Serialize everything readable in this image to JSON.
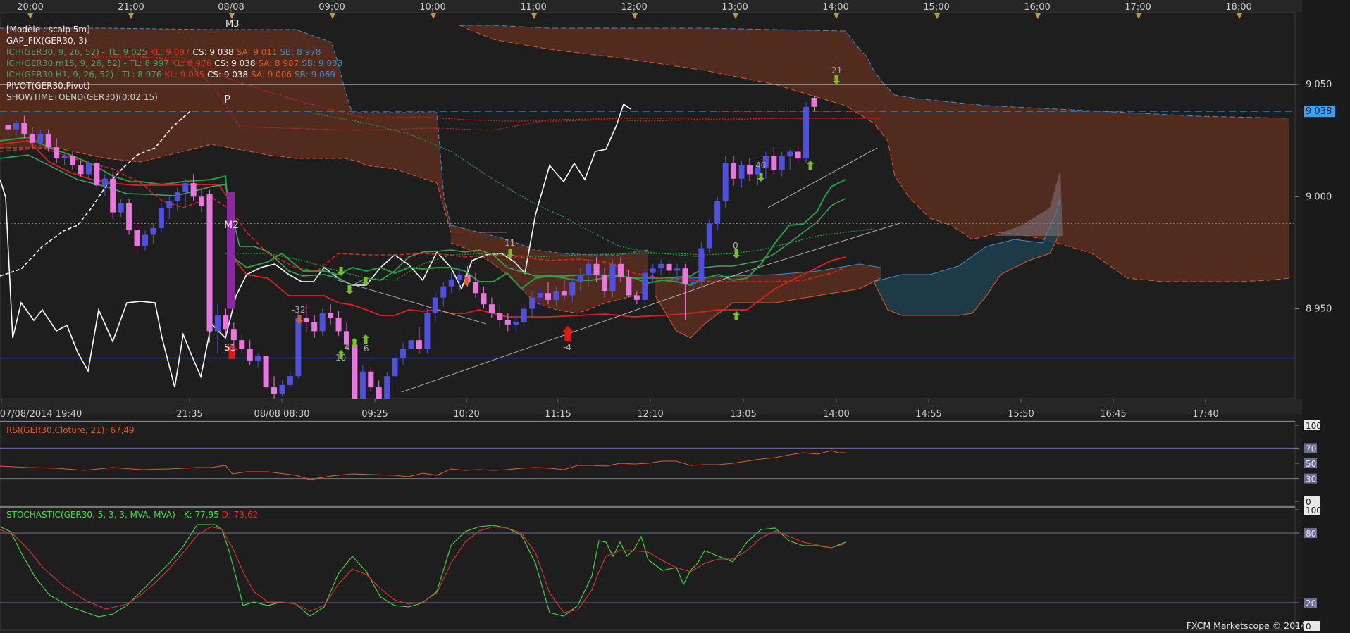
{
  "top_axis": [
    "20:00",
    "21:00",
    "08/08",
    "09:00",
    "10:00",
    "11:00",
    "12:00",
    "13:00",
    "14:00",
    "15:00",
    "16:00",
    "17:00",
    "18:00"
  ],
  "bottom_axis": [
    "07/08/2014 19:40",
    "21:35",
    "08/08 08:30",
    "09:25",
    "10:20",
    "11:15",
    "12:10",
    "13:05",
    "14:00",
    "14:55",
    "15:50",
    "16:45",
    "17:40"
  ],
  "legend": {
    "model": "[Modèle : scalp 5m]",
    "gap": "GAP_FIX(GER30, 3)",
    "ich5": {
      "name": "ICH(GER30, 9, 26, 52) -",
      "tl": "TL: 9 025",
      "kl": "KL: 9 097",
      "cs": "CS: 9 038",
      "sa": "SA: 9 011",
      "sb": "SB: 8 978"
    },
    "ich15": {
      "name": "ICH(GER30.m15, 9, 26, 52) -",
      "tl": "TL: 8 997",
      "kl": "KL: 8 976",
      "cs": "CS: 9 038",
      "sa": "SA: 8 987",
      "sb": "SB: 9 033"
    },
    "ichH1": {
      "name": "ICH(GER30.H1, 9, 26, 52) -",
      "tl": "TL: 8 976",
      "kl": "KL: 9 035",
      "cs": "CS: 9 038",
      "sa": "SA: 9 006",
      "sb": "SB: 9 069"
    },
    "pivot": "PIVOT(GER30,Pivot)",
    "showtime": "SHOWTIMETOEND(GER30)(0:02:15)"
  },
  "price_axis": {
    "ticks": [
      "9 050",
      "9 000",
      "8 950"
    ],
    "last_price": "9 038"
  },
  "chart_labels": [
    "M3",
    "P",
    "M2",
    "S1",
    "-32",
    "4",
    "10",
    "6",
    "11",
    "-4",
    "0",
    "40",
    "21"
  ],
  "rsi": {
    "title": "RSI(GER30.Cloture, 21): 67,49",
    "levels": [
      "100",
      "70",
      "50",
      "30",
      "0"
    ]
  },
  "stochastic": {
    "title": "STOCHASTIC(GER30, 5, 3, 3, MVA, MVA) -",
    "k": "K: 77,95",
    "d": "D: 73,62",
    "levels": [
      "100",
      "80",
      "20",
      "0"
    ]
  },
  "credit": "FXCM Marketscope © 2014",
  "colors": {
    "bull_candle": "#5050e0",
    "bear_candle": "#e878e0",
    "tenkan": "#e02020",
    "kijun": "#20a040",
    "cloud_bear": "#5a2e1f",
    "cloud_bull": "#1e3f4e",
    "chikou": "#ffffff"
  },
  "chart_data": {
    "type": "candlestick",
    "symbol": "GER30",
    "timeframe": "5m",
    "ylim": [
      8910,
      9082
    ],
    "candles": [
      [
        9032,
        9035,
        9028,
        9030
      ],
      [
        9030,
        9034,
        9027,
        9033
      ],
      [
        9033,
        9036,
        9026,
        9028
      ],
      [
        9028,
        9031,
        9022,
        9024
      ],
      [
        9024,
        9030,
        9022,
        9028
      ],
      [
        9028,
        9030,
        9020,
        9022
      ],
      [
        9022,
        9026,
        9015,
        9017
      ],
      [
        9017,
        9020,
        9014,
        9018
      ],
      [
        9018,
        9020,
        9012,
        9014
      ],
      [
        9014,
        9016,
        9009,
        9010
      ],
      [
        9010,
        9016,
        9008,
        9015
      ],
      [
        9015,
        9017,
        9003,
        9005
      ],
      [
        9005,
        9010,
        9000,
        9008
      ],
      [
        9008,
        9011,
        8990,
        8993
      ],
      [
        8993,
        8999,
        8991,
        8997
      ],
      [
        8997,
        8999,
        8983,
        8985
      ],
      [
        8985,
        8990,
        8974,
        8978
      ],
      [
        8978,
        8985,
        8976,
        8983
      ],
      [
        8983,
        8988,
        8979,
        8986
      ],
      [
        8986,
        8997,
        8984,
        8995
      ],
      [
        8995,
        9000,
        8990,
        8998
      ],
      [
        8998,
        9004,
        8994,
        9002
      ],
      [
        9002,
        9008,
        8996,
        9006
      ],
      [
        9006,
        9010,
        8998,
        9000
      ],
      [
        9000,
        9004,
        8993,
        8996
      ],
      [
        9001,
        9003,
        8935,
        8940
      ],
      [
        8940,
        8952,
        8930,
        8947
      ],
      [
        8947,
        8950,
        8938,
        8941
      ],
      [
        8941,
        8944,
        8933,
        8936
      ],
      [
        8936,
        8939,
        8930,
        8932
      ],
      [
        8932,
        8936,
        8925,
        8927
      ],
      [
        8927,
        8930,
        8924,
        8929
      ],
      [
        8929,
        8932,
        8913,
        8915
      ],
      [
        8915,
        8920,
        8910,
        8912
      ],
      [
        8912,
        8918,
        8911,
        8916
      ],
      [
        8916,
        8922,
        8915,
        8920
      ],
      [
        8920,
        8948,
        8919,
        8946
      ],
      [
        8946,
        8952,
        8940,
        8944
      ],
      [
        8944,
        8947,
        8937,
        8940
      ],
      [
        8940,
        8950,
        8938,
        8948
      ],
      [
        8948,
        8952,
        8943,
        8946
      ],
      [
        8946,
        8949,
        8938,
        8940
      ],
      [
        8940,
        8944,
        8932,
        8934
      ],
      [
        8934,
        8936,
        8900,
        8903
      ],
      [
        8903,
        8925,
        8901,
        8922
      ],
      [
        8922,
        8924,
        8913,
        8915
      ],
      [
        8915,
        8918,
        8905,
        8908
      ],
      [
        8908,
        8922,
        8906,
        8920
      ],
      [
        8920,
        8930,
        8918,
        8928
      ],
      [
        8928,
        8935,
        8925,
        8932
      ],
      [
        8932,
        8938,
        8929,
        8936
      ],
      [
        8936,
        8942,
        8930,
        8932
      ],
      [
        8932,
        8950,
        8930,
        8948
      ],
      [
        8948,
        8958,
        8944,
        8955
      ],
      [
        8955,
        8962,
        8951,
        8960
      ],
      [
        8960,
        8966,
        8957,
        8963
      ],
      [
        8963,
        8968,
        8958,
        8965
      ],
      [
        8965,
        8969,
        8960,
        8962
      ],
      [
        8962,
        8966,
        8955,
        8957
      ],
      [
        8957,
        8960,
        8950,
        8952
      ],
      [
        8952,
        8955,
        8946,
        8948
      ],
      [
        8948,
        8952,
        8942,
        8945
      ],
      [
        8945,
        8948,
        8940,
        8943
      ],
      [
        8943,
        8947,
        8940,
        8944
      ],
      [
        8944,
        8952,
        8941,
        8950
      ],
      [
        8950,
        8958,
        8946,
        8955
      ],
      [
        8955,
        8960,
        8950,
        8957
      ],
      [
        8957,
        8962,
        8952,
        8954
      ],
      [
        8954,
        8960,
        8951,
        8958
      ],
      [
        8958,
        8963,
        8954,
        8956
      ],
      [
        8956,
        8964,
        8953,
        8962
      ],
      [
        8962,
        8968,
        8958,
        8965
      ],
      [
        8965,
        8972,
        8960,
        8970
      ],
      [
        8970,
        8973,
        8962,
        8965
      ],
      [
        8965,
        8968,
        8955,
        8958
      ],
      [
        8958,
        8972,
        8955,
        8970
      ],
      [
        8970,
        8973,
        8962,
        8964
      ],
      [
        8964,
        8967,
        8955,
        8956
      ],
      [
        8956,
        8958,
        8952,
        8954
      ],
      [
        8954,
        8968,
        8952,
        8966
      ],
      [
        8966,
        8970,
        8962,
        8968
      ],
      [
        8968,
        8972,
        8965,
        8970
      ],
      [
        8970,
        8972,
        8965,
        8967
      ],
      [
        8967,
        8970,
        8962,
        8968
      ],
      [
        8968,
        8970,
        8945,
        8961
      ],
      [
        8961,
        8966,
        8958,
        8962
      ],
      [
        8962,
        8980,
        8960,
        8977
      ],
      [
        8977,
        8990,
        8975,
        8988
      ],
      [
        8988,
        9000,
        8985,
        8998
      ],
      [
        8998,
        9018,
        8995,
        9015
      ],
      [
        9015,
        9018,
        9005,
        9008
      ],
      [
        9008,
        9016,
        9004,
        9014
      ],
      [
        9014,
        9017,
        9007,
        9010
      ],
      [
        9010,
        9015,
        9005,
        9013
      ],
      [
        9013,
        9020,
        9008,
        9018
      ],
      [
        9018,
        9022,
        9010,
        9012
      ],
      [
        9012,
        9020,
        9009,
        9018
      ],
      [
        9018,
        9021,
        9012,
        9020
      ],
      [
        9020,
        9022,
        9015,
        9017
      ],
      [
        9017,
        9042,
        9015,
        9040
      ],
      [
        9044,
        9045,
        9038,
        9040
      ]
    ]
  }
}
